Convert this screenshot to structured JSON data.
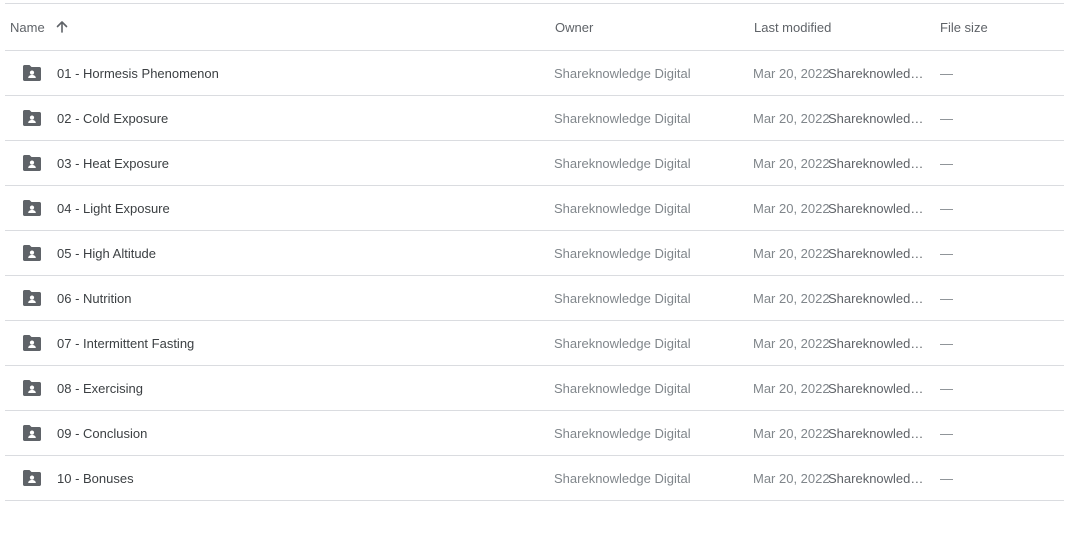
{
  "columns": {
    "name": "Name",
    "owner": "Owner",
    "last_modified": "Last modified",
    "file_size": "File size",
    "sort_icon": "arrow-up-icon"
  },
  "row_icon": "shared-folder-icon",
  "colors": {
    "border": "#dadce0",
    "icon": "#5f6368",
    "secondary_text": "#80868b",
    "primary_text": "#3c4043"
  },
  "rows": [
    {
      "name": "01 - Hormesis Phenomenon",
      "owner": "Shareknowledge Digital",
      "date": "Mar 20, 2022",
      "modified_by": "Shareknowledge Digital",
      "size": "—"
    },
    {
      "name": "02 - Cold Exposure",
      "owner": "Shareknowledge Digital",
      "date": "Mar 20, 2022",
      "modified_by": "Shareknowledge Digital",
      "size": "—"
    },
    {
      "name": "03 - Heat Exposure",
      "owner": "Shareknowledge Digital",
      "date": "Mar 20, 2022",
      "modified_by": "Shareknowledge Digital",
      "size": "—"
    },
    {
      "name": "04 - Light Exposure",
      "owner": "Shareknowledge Digital",
      "date": "Mar 20, 2022",
      "modified_by": "Shareknowledge Digital",
      "size": "—"
    },
    {
      "name": "05 - High Altitude",
      "owner": "Shareknowledge Digital",
      "date": "Mar 20, 2022",
      "modified_by": "Shareknowledge Digital",
      "size": "—"
    },
    {
      "name": "06 - Nutrition",
      "owner": "Shareknowledge Digital",
      "date": "Mar 20, 2022",
      "modified_by": "Shareknowledge Digital",
      "size": "—"
    },
    {
      "name": "07 - Intermittent Fasting",
      "owner": "Shareknowledge Digital",
      "date": "Mar 20, 2022",
      "modified_by": "Shareknowledge Digital",
      "size": "—"
    },
    {
      "name": "08 - Exercising",
      "owner": "Shareknowledge Digital",
      "date": "Mar 20, 2022",
      "modified_by": "Shareknowledge Digital",
      "size": "—"
    },
    {
      "name": "09 - Conclusion",
      "owner": "Shareknowledge Digital",
      "date": "Mar 20, 2022",
      "modified_by": "Shareknowledge Digital",
      "size": "—"
    },
    {
      "name": "10 - Bonuses",
      "owner": "Shareknowledge Digital",
      "date": "Mar 20, 2022",
      "modified_by": "Shareknowledge Digital",
      "size": "—"
    }
  ]
}
